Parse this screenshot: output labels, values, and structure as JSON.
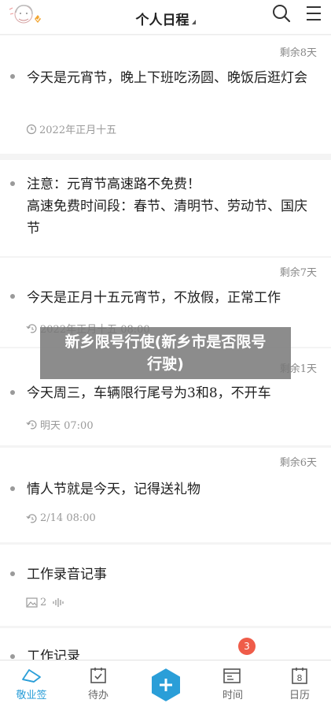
{
  "header": {
    "title": "个人日程"
  },
  "items": [
    {
      "remaining": "剩余8天",
      "text": "今天是元宵节，晚上下班吃汤圆、晚饭后逛灯会",
      "meta": "2022年正月十五"
    },
    {
      "remaining": "",
      "text_line1": "注意：元宵节高速路不免费！",
      "text_line2": "高速免费时间段：春节、清明节、劳动节、国庆节"
    },
    {
      "remaining": "剩余7天",
      "text": "今天是正月十五元宵节，不放假，正常工作",
      "meta": "2022年正月十五 08:00"
    },
    {
      "remaining": "剩余1天",
      "text": "今天周三，车辆限行尾号为3和8，不开车",
      "meta": "明天 07:00"
    },
    {
      "remaining": "剩余6天",
      "text": "情人节就是今天，记得送礼物",
      "meta": "2/14 08:00"
    },
    {
      "remaining": "",
      "text": "工作录音记事",
      "meta": "2"
    },
    {
      "remaining": "",
      "text": "工作记录"
    }
  ],
  "overlay": {
    "line1": "新乡限号行使(新乡市是否限号",
    "line2": "行驶)"
  },
  "tabbar": {
    "tabs": [
      {
        "label": "敬业签"
      },
      {
        "label": "待办"
      },
      {
        "label": "时间"
      },
      {
        "label": "日历"
      }
    ],
    "badge": "3",
    "calendar_day": "8"
  },
  "colors": {
    "accent": "#2a9ed8",
    "badge": "#ef5c49",
    "background": "#f4f4f4"
  }
}
